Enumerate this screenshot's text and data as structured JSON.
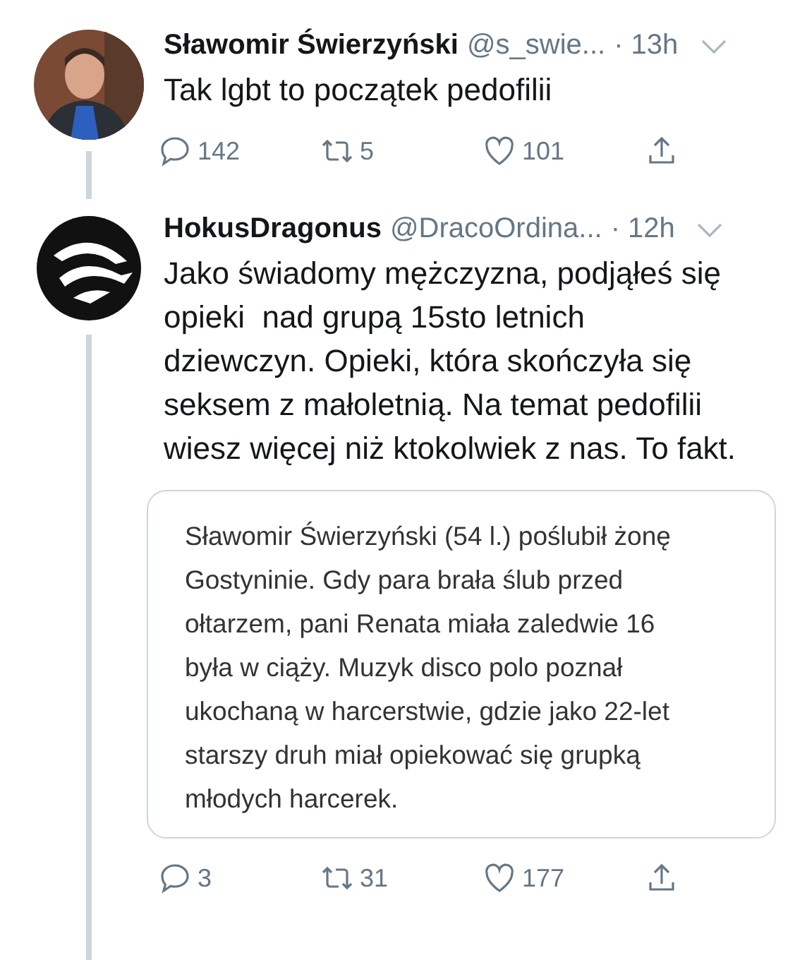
{
  "tweets": [
    {
      "kind": "person",
      "name": "Sławomir Świerzyński",
      "handle": "@s_swie...",
      "time": "· 13h",
      "text": "Tak lgbt to początek pedofilii",
      "actions": {
        "replies": "142",
        "retweets": "5",
        "likes": "101"
      }
    },
    {
      "kind": "logo",
      "name": "HokusDragonus",
      "handle": "@DracoOrdina...",
      "time": "· 12h",
      "text": "Jako świadomy mężczyzna, podjąłeś się opieki  nad grupą 15sto letnich dziewczyn. Opieki, która skończyła się seksem z małoletnią. Na temat pedofilii wiesz więcej niż ktokolwiek z nas. To fakt.",
      "quote_lines": [
        "Sławomir Świerzyński (54 l.) poślubił żonę",
        "Gostyninie. Gdy para brała ślub przed",
        "ołtarzem, pani Renata miała zaledwie 16",
        "była w ciąży. Muzyk disco polo poznał",
        "ukochaną w harcerstwie, gdzie jako 22-let",
        "starszy druh miał opiekować się grupką",
        "młodych harcerek."
      ],
      "actions": {
        "replies": "3",
        "retweets": "31",
        "likes": "177"
      }
    }
  ]
}
